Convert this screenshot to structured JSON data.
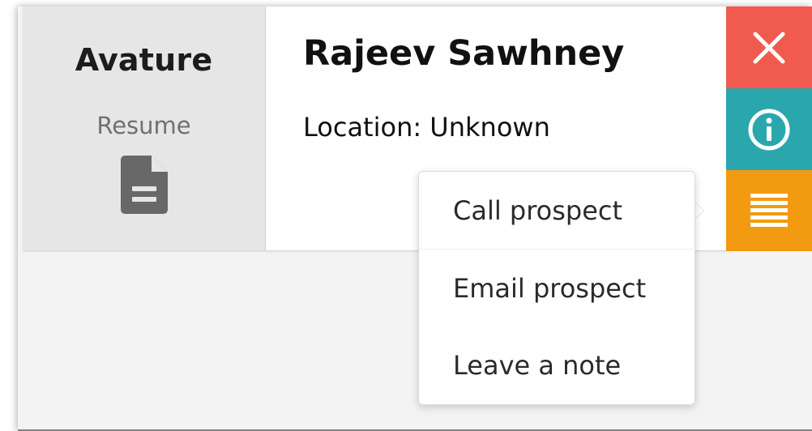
{
  "sidebar": {
    "brand": "Avature",
    "resume_label": "Resume",
    "resume_icon": "document-icon"
  },
  "profile": {
    "name": "Rajeev Sawhney",
    "location": "Location: Unknown"
  },
  "actions": {
    "close_icon": "close-icon",
    "info_icon": "info-icon",
    "menu_icon": "menu-icon",
    "colors": {
      "close": "#f05a4f",
      "info": "#2aa7ad",
      "menu": "#f29a10"
    }
  },
  "menu": {
    "items": [
      {
        "label": "Call prospect"
      },
      {
        "label": "Email prospect"
      },
      {
        "label": "Leave a note"
      }
    ]
  }
}
